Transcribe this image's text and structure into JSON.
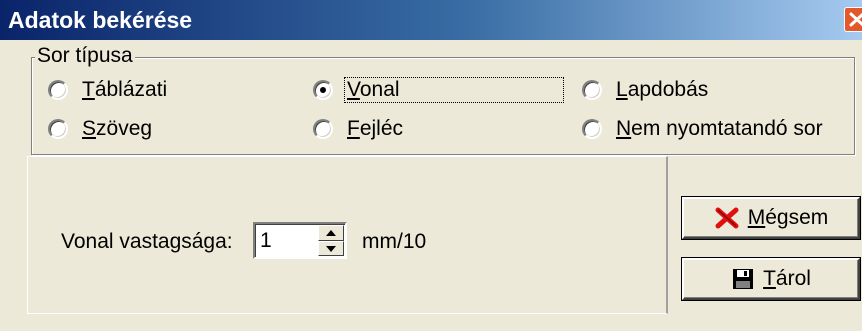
{
  "window": {
    "title": "Adatok bekérése",
    "close_icon": "close-icon"
  },
  "row_type_group": {
    "legend": "Sor típusa",
    "selected": "Vonal",
    "options": [
      {
        "label_acc": "T",
        "label_rest": "áblázati",
        "selected": false
      },
      {
        "label_acc": "V",
        "label_rest": "onal",
        "selected": true
      },
      {
        "label_acc": "L",
        "label_rest": "apdobás",
        "selected": false
      },
      {
        "label_acc": "S",
        "label_rest": "zöveg",
        "selected": false
      },
      {
        "label_pre": "",
        "label_acc": "F",
        "label_rest": "ejléc",
        "selected": false
      },
      {
        "label_acc": "N",
        "label_rest": "em nyomtatandó sor",
        "selected": false
      }
    ]
  },
  "line_width": {
    "label": "Vonal vastagsága:",
    "value": "1",
    "unit": "mm/10"
  },
  "buttons": {
    "cancel": {
      "acc": "M",
      "rest": "égsem",
      "icon": "red-x-icon"
    },
    "save": {
      "acc": "T",
      "rest": "árol",
      "icon": "floppy-disk-icon"
    }
  },
  "colors": {
    "title_gradient_start": "#0a246a",
    "title_gradient_end": "#a6caf0",
    "face": "#ece9d8",
    "cancel_icon": "#e01010"
  }
}
